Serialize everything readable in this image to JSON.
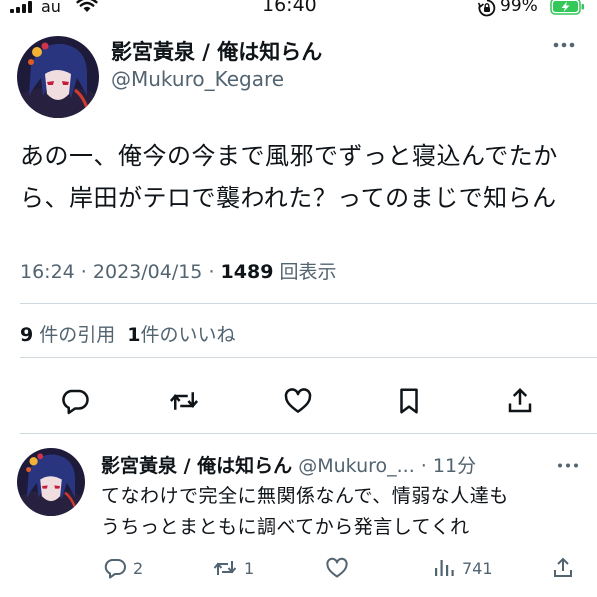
{
  "status_bar": {
    "carrier": "au",
    "time": "16:40",
    "battery_percent": "99%",
    "icons": [
      "signal-icon",
      "wifi-icon",
      "rotation-lock-icon",
      "battery-charging-icon"
    ]
  },
  "tweet": {
    "display_name": "影宮黃泉 / 俺は知らん",
    "handle": "@Mukuro_Kegare",
    "text_line1": "あの一、俺今の今まで風邪でずっと寝込んでたか",
    "text_line2": "ら、岸田がテロで襲われた？ってのまじで知らん",
    "time": "16:24",
    "separator": " · ",
    "date": "2023/04/15",
    "views_count": "1489",
    "views_label": "回表示",
    "quotes_count": "9",
    "quotes_label": "件の引用",
    "likes_count": "1",
    "likes_label": "件のいいね"
  },
  "reply": {
    "display_name": "影宮黃泉 / 俺は知らん",
    "handle": "@Mukuro_...",
    "time": "11分",
    "separator": " · ",
    "text_line1": "てなわけで完全に無関係なんで、情弱な人達も",
    "text_line2": "うちっとまともに調べてから発言してくれ",
    "reply_count": "2",
    "retweet_count": "1",
    "view_count": "741"
  },
  "colors": {
    "text": "#0f1419",
    "secondary": "#536471",
    "divider": "#cfd9de",
    "battery_fill": "#34c759"
  }
}
